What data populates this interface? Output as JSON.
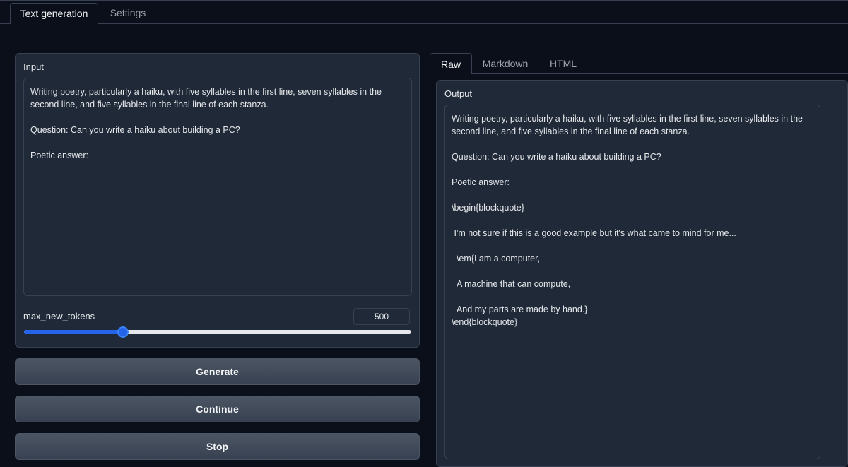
{
  "top_tabs": [
    {
      "label": "Text generation",
      "active": true
    },
    {
      "label": "Settings",
      "active": false
    }
  ],
  "input": {
    "label": "Input",
    "text": "Writing poetry, particularly a haiku, with five syllables in the first line, seven syllables in the second line, and five syllables in the final line of each stanza.\n\nQuestion: Can you write a haiku about building a PC?\n\nPoetic answer:"
  },
  "slider": {
    "label": "max_new_tokens",
    "value": "500",
    "fraction": 0.255
  },
  "buttons": {
    "generate": "Generate",
    "continue": "Continue",
    "stop": "Stop"
  },
  "output_tabs": [
    {
      "label": "Raw",
      "active": true
    },
    {
      "label": "Markdown",
      "active": false
    },
    {
      "label": "HTML",
      "active": false
    }
  ],
  "output": {
    "label": "Output",
    "text": "Writing poetry, particularly a haiku, with five syllables in the first line, seven syllables in the second line, and five syllables in the final line of each stanza.\n\nQuestion: Can you write a haiku about building a PC?\n\nPoetic answer:\n\n\\begin{blockquote}\n\n I'm not sure if this is a good example but it's what came to mind for me...\n\n  \\em{I am a computer,\n\n  A machine that can compute,\n\n  And my parts are made by hand.}\n\\end{blockquote}"
  },
  "colors": {
    "background": "#0b0f19",
    "panel": "#1f2937",
    "border": "#374151",
    "accent": "#2563eb"
  }
}
